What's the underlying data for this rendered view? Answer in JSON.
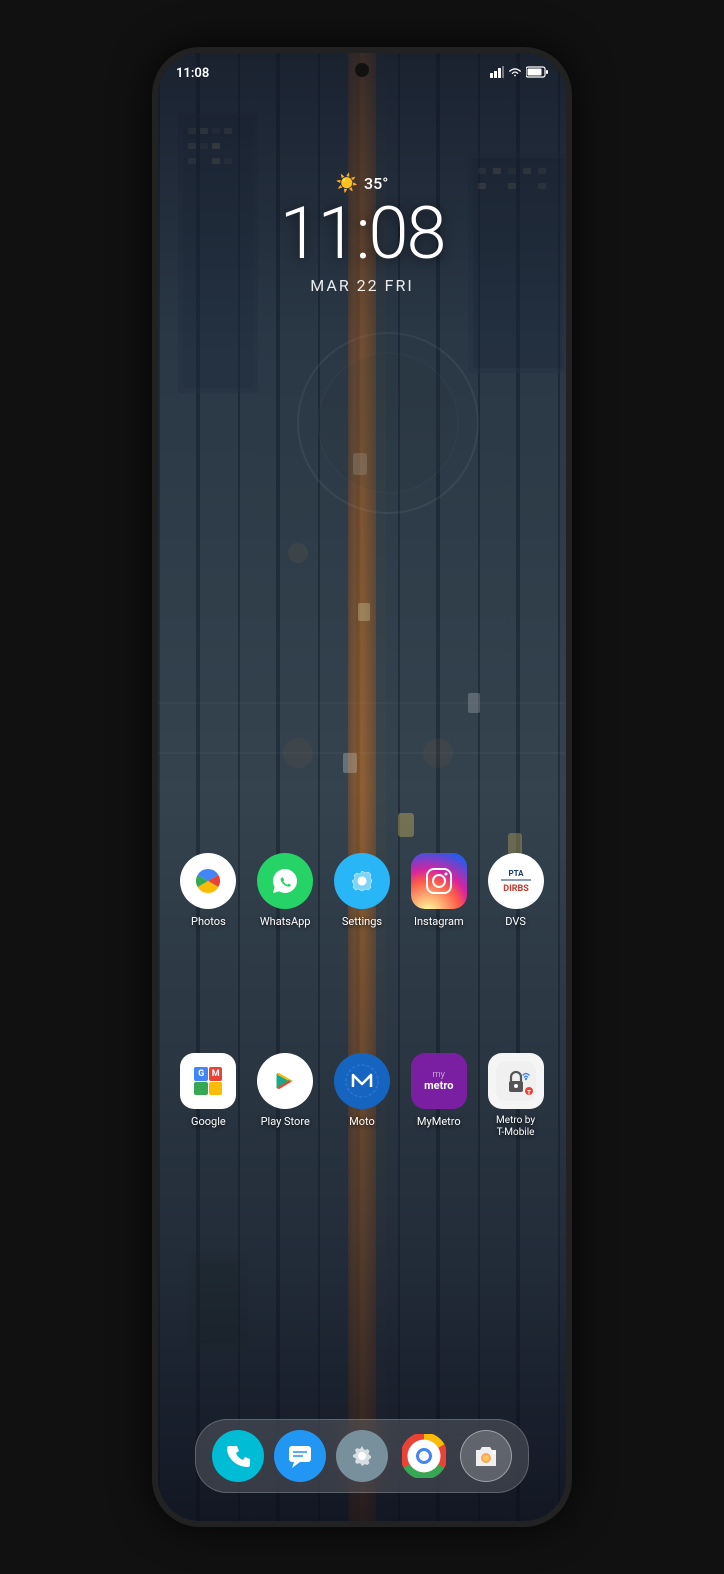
{
  "device": {
    "background_color": "#111"
  },
  "status_bar": {
    "time": "11:08",
    "icons": [
      "signal",
      "wifi",
      "battery"
    ]
  },
  "clock_widget": {
    "weather_icon": "☀️",
    "temperature": "35°",
    "time": "11:08",
    "date": "MAR 22  FRI"
  },
  "app_row_1": {
    "apps": [
      {
        "id": "photos",
        "label": "Photos",
        "icon_type": "photos"
      },
      {
        "id": "whatsapp",
        "label": "WhatsApp",
        "icon_type": "whatsapp"
      },
      {
        "id": "settings",
        "label": "Settings",
        "icon_type": "settings"
      },
      {
        "id": "instagram",
        "label": "Instagram",
        "icon_type": "instagram"
      },
      {
        "id": "dvs",
        "label": "DVS",
        "icon_type": "dvs"
      }
    ]
  },
  "app_row_2": {
    "apps": [
      {
        "id": "google",
        "label": "Google",
        "icon_type": "google"
      },
      {
        "id": "playstore",
        "label": "Play Store",
        "icon_type": "playstore"
      },
      {
        "id": "moto",
        "label": "Moto",
        "icon_type": "moto"
      },
      {
        "id": "mymetro",
        "label": "MyMetro",
        "icon_type": "mymetro"
      },
      {
        "id": "metro-tmobile",
        "label": "Metro by\nT-Mobile",
        "icon_type": "metrotmobile"
      }
    ]
  },
  "dock": {
    "items": [
      {
        "id": "phone",
        "label": "Phone",
        "icon": "📞"
      },
      {
        "id": "messages",
        "label": "Messages",
        "icon": "💬"
      },
      {
        "id": "settings-dock",
        "label": "Settings",
        "icon": "⚙️"
      },
      {
        "id": "chrome",
        "label": "Chrome",
        "icon": "chrome"
      },
      {
        "id": "camera",
        "label": "Camera",
        "icon": "📷"
      }
    ]
  }
}
